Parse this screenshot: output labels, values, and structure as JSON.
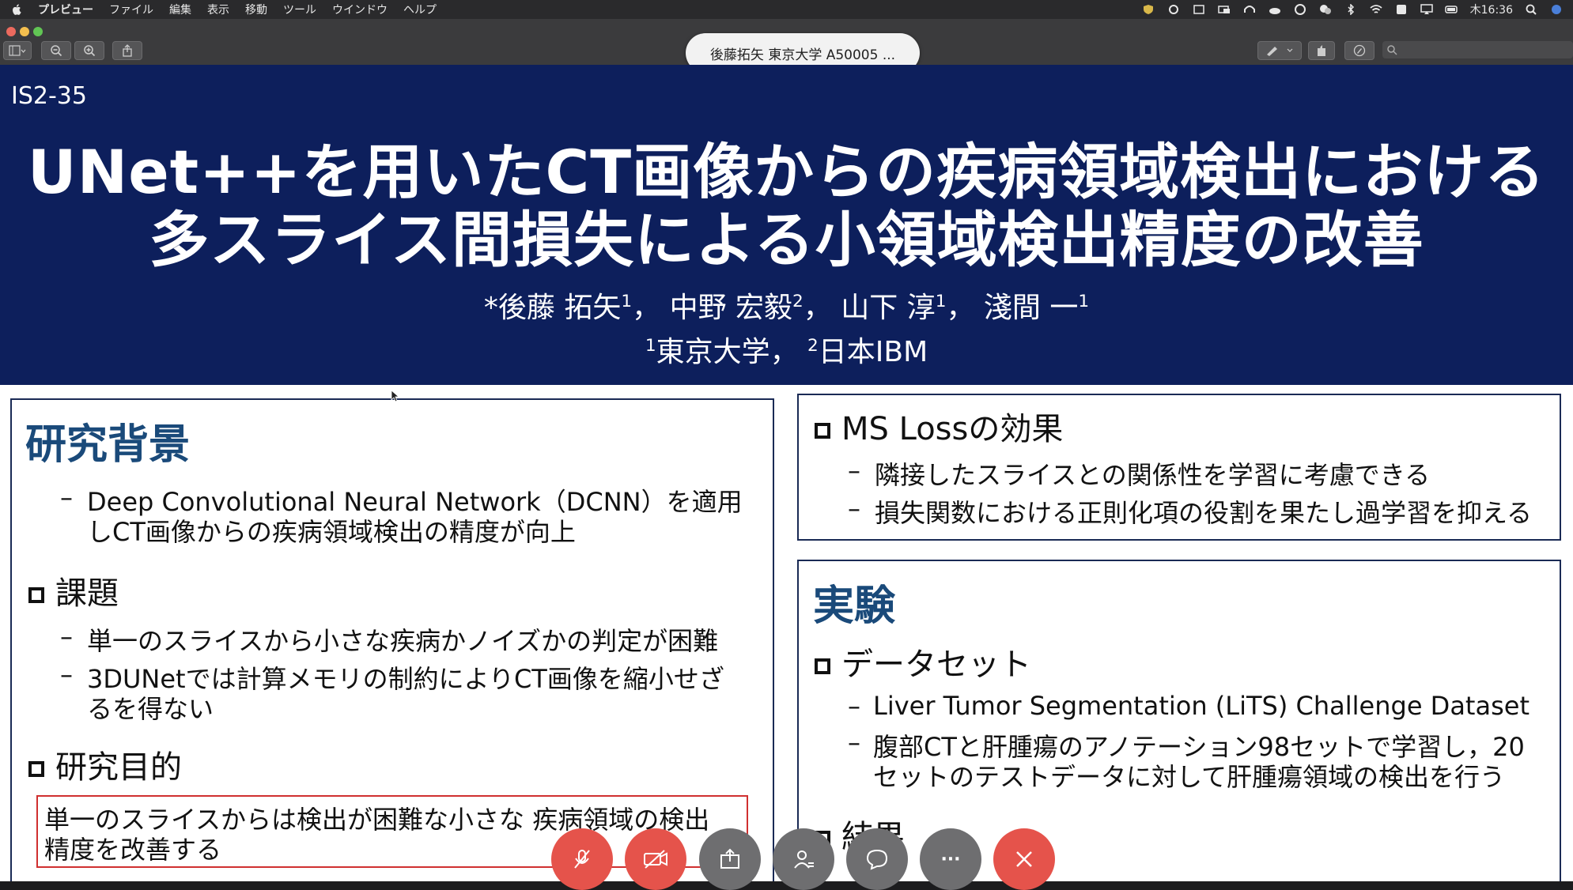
{
  "menubar": {
    "items": [
      "プレビュー",
      "ファイル",
      "編集",
      "表示",
      "移動",
      "ツール",
      "ウインドウ",
      "ヘルプ"
    ],
    "clock": "木16:36"
  },
  "toolbar": {
    "presenter_name": "後藤拓矢 東京大学 A50005 ..."
  },
  "slide": {
    "code": "IS2-35",
    "title_line1": "UNet++を用いたCT画像からの疾病領域検出における",
    "title_line2": "多スライス間損失による小領域検出精度の改善",
    "authors": {
      "a1": "*後藤 拓矢",
      "a1_sup": "1",
      "a2": "中野 宏毅",
      "a2_sup": "2",
      "a3": "山下 淳",
      "a3_sup": "1",
      "a4": "淺間 一",
      "a4_sup": "1",
      "sep": "，"
    },
    "affiliations": {
      "sup1": "1",
      "aff1": "東京大学",
      "sep": "，",
      "sup2": "2",
      "aff2": "日本IBM"
    },
    "left": {
      "heading": "研究背景",
      "bullet1_line1": "Deep Convolutional Neural Network（DCNN）を適用",
      "bullet1_line2": "しCT画像からの疾病領域検出の精度が向上",
      "sub1": "課題",
      "sub1_b1": "単一のスライスから小さな疾病かノイズかの判定が困難",
      "sub1_b2_line1": "3DUNetでは計算メモリの制約によりCT画像を縮小せざ",
      "sub1_b2_line2": "るを得ない",
      "sub2": "研究目的",
      "goal_line1": "単一のスライスからは検出が困難な小さな 疾病領域の検出",
      "goal_line2": "精度を改善する"
    },
    "right_top": {
      "heading": "MS Lossの効果",
      "b1": "隣接したスライスとの関係性を学習に考慮できる",
      "b2": "損失関数における正則化項の役割を果たし過学習を抑える"
    },
    "right_bottom": {
      "heading": "実験",
      "sub1": "データセット",
      "b1": "Liver Tumor Segmentation (LiTS) Challenge Dataset",
      "b2_line1": "腹部CTと肝腫瘍のアノテーション98セットで学習し，20",
      "b2_line2": "セットのテストデータに対して肝腫瘍領域の検出を行う",
      "sub2": "結果"
    },
    "dash": "–"
  },
  "controls": {
    "items": [
      "mic-muted-icon",
      "camera-off-icon",
      "share-icon",
      "participants-icon",
      "chat-icon",
      "more-icon",
      "leave-icon"
    ],
    "more_label": "···"
  },
  "colors": {
    "banner": "#0d1f5c",
    "heading": "#1a4a7a",
    "control_red": "#e5534b",
    "control_gray": "#6e6e70",
    "goal_border": "#d03030"
  }
}
